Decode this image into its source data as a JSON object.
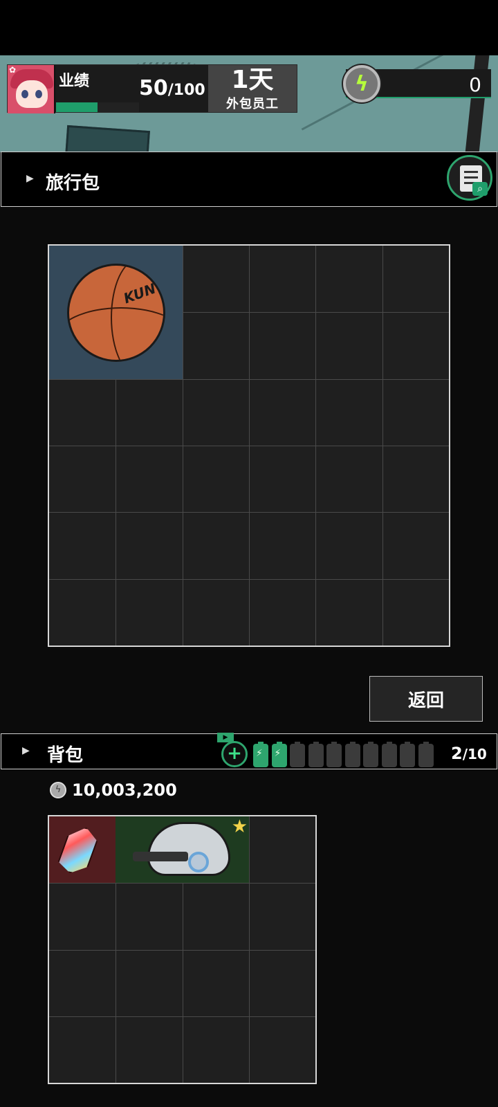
{
  "hud": {
    "performance_label": "业绩",
    "performance_current": "50",
    "performance_max": "/100",
    "performance_progress": 0.5,
    "day_count": "1天",
    "role": "外包员工",
    "energy_value": "0"
  },
  "travel_bag": {
    "title": "旅行包",
    "columns": 6,
    "rows": 6,
    "items": [
      {
        "name": "basketball",
        "brand_text": "KUN"
      }
    ]
  },
  "return_button": "返回",
  "backpack": {
    "title": "背包",
    "ad_tag": "▶",
    "capacity_current": "2",
    "capacity_max": "/10",
    "batteries_filled": 2,
    "batteries_total": 10,
    "coin_amount": "10,003,200",
    "columns": 4,
    "rows": 4,
    "items": [
      {
        "name": "rainbow-crystal",
        "rarity": "red"
      },
      {
        "name": "helmet",
        "rarity": "green",
        "starred": true
      }
    ]
  },
  "colors": {
    "accent_green": "#2ea56e",
    "basketball_slot": "#34495a",
    "crystal_slot": "#521d1f",
    "helmet_slot": "#1e3b20"
  },
  "icons": [
    "gear-icon",
    "clipboard-search-icon",
    "energy-bolt-icon",
    "plus-icon",
    "battery-icon",
    "coin-icon",
    "star-icon"
  ]
}
